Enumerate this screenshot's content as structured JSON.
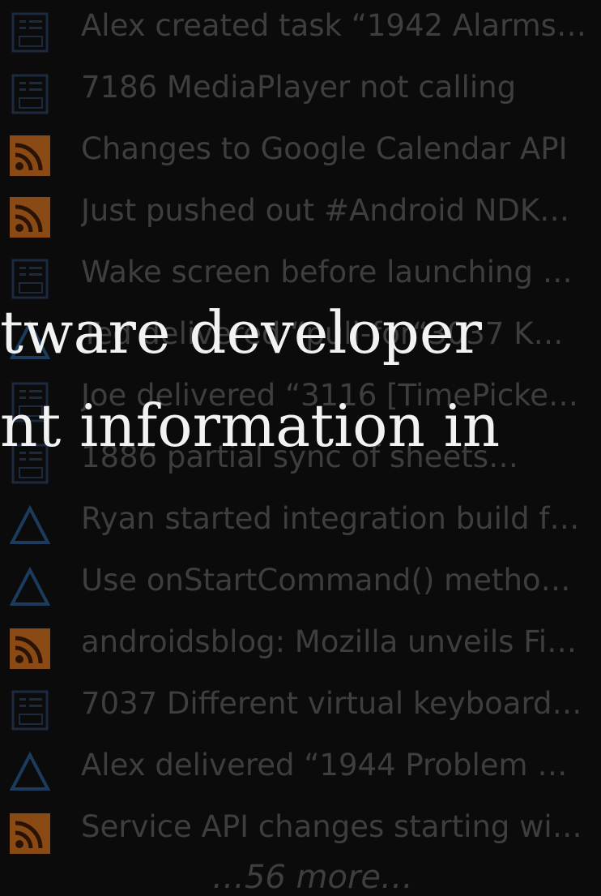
{
  "feed": {
    "items": [
      {
        "type": "task-icon",
        "text": "Alex created task “1942 Alarms…"
      },
      {
        "type": "task-icon",
        "text": "7186 MediaPlayer not calling"
      },
      {
        "type": "rss-icon",
        "text": "Changes to Google Calendar API"
      },
      {
        "type": "rss-icon",
        "text": "Just pushed out #Android NDK…"
      },
      {
        "type": "task-icon",
        "text": "Wake screen before launching …"
      },
      {
        "type": "triangle-icon",
        "text": "Ted delivered “pull-for“3037 K…"
      },
      {
        "type": "task-icon",
        "text": "Joe delivered “3116 [TimePicke…"
      },
      {
        "type": "task-icon",
        "text": "1886 partial sync of sheets…"
      },
      {
        "type": "triangle-icon",
        "text": "Ryan started integration build f…"
      },
      {
        "type": "triangle-icon",
        "text": "Use onStartCommand() metho…"
      },
      {
        "type": "rss-icon",
        "text": "androidsblog: Mozilla unveils Fi…"
      },
      {
        "type": "task-icon",
        "text": "7037 Different virtual keyboard…"
      },
      {
        "type": "triangle-icon",
        "text": "Alex delivered “1944 Problem …"
      },
      {
        "type": "rss-icon",
        "text": "Service API changes starting wi…"
      }
    ],
    "more_label": "…56 more…"
  },
  "overlay": {
    "line1": "tware developer",
    "line2": "nt information in"
  },
  "colors": {
    "background": "#0b0b0c",
    "feed_text": "#3e3e41",
    "overlay_text": "#f2f2f2",
    "rss_orange": "#8a4a15",
    "task_blue": "#1b2a3e",
    "triangle_blue": "#1d3b5c"
  }
}
